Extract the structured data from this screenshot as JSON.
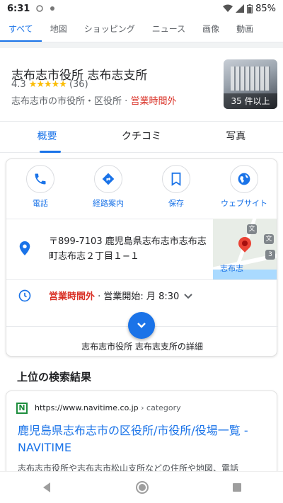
{
  "status_bar": {
    "time": "6:31",
    "battery": "85%"
  },
  "search_tabs": [
    "すべて",
    "地図",
    "ショッピング",
    "ニュース",
    "画像",
    "動画"
  ],
  "place": {
    "title": "志布志市役所 志布志支所",
    "rating": "4.3",
    "stars": "★★★★★",
    "review_count": "(36)",
    "category": "志布志市の市役所・区役所",
    "separator": "·",
    "status": "営業時間外",
    "photo_label": "35 件以上"
  },
  "place_tabs": [
    "概要",
    "クチコミ",
    "写真"
  ],
  "actions": [
    {
      "label": "電話",
      "icon": "phone-icon"
    },
    {
      "label": "経路案内",
      "icon": "directions-icon"
    },
    {
      "label": "保存",
      "icon": "bookmark-icon"
    },
    {
      "label": "ウェブサイト",
      "icon": "globe-icon"
    }
  ],
  "address": "〒899-7103 鹿児島県志布志市志布志町志布志２丁目１−１",
  "map": {
    "label": "志布志",
    "badge_a": "文",
    "badge_b": "文",
    "route": "3"
  },
  "hours": {
    "status": "営業時間外",
    "detail": "· 営業開始: 月 8:30"
  },
  "detail_link": "志布志市役所 志布志支所の詳細",
  "section_title": "上位の検索結果",
  "result": {
    "favicon": "N",
    "url": "https://www.navitime.co.jp",
    "crumb": "› category",
    "title": "鹿児島県志布志市の区役所/市役所/役場一覧 - NAVITIME",
    "snippet": "志布志市役所や志布志市松山支所などの住所や地図、電話"
  },
  "colors": {
    "accent": "#1a73e8",
    "closed": "#d93025",
    "star": "#fbbc04"
  }
}
